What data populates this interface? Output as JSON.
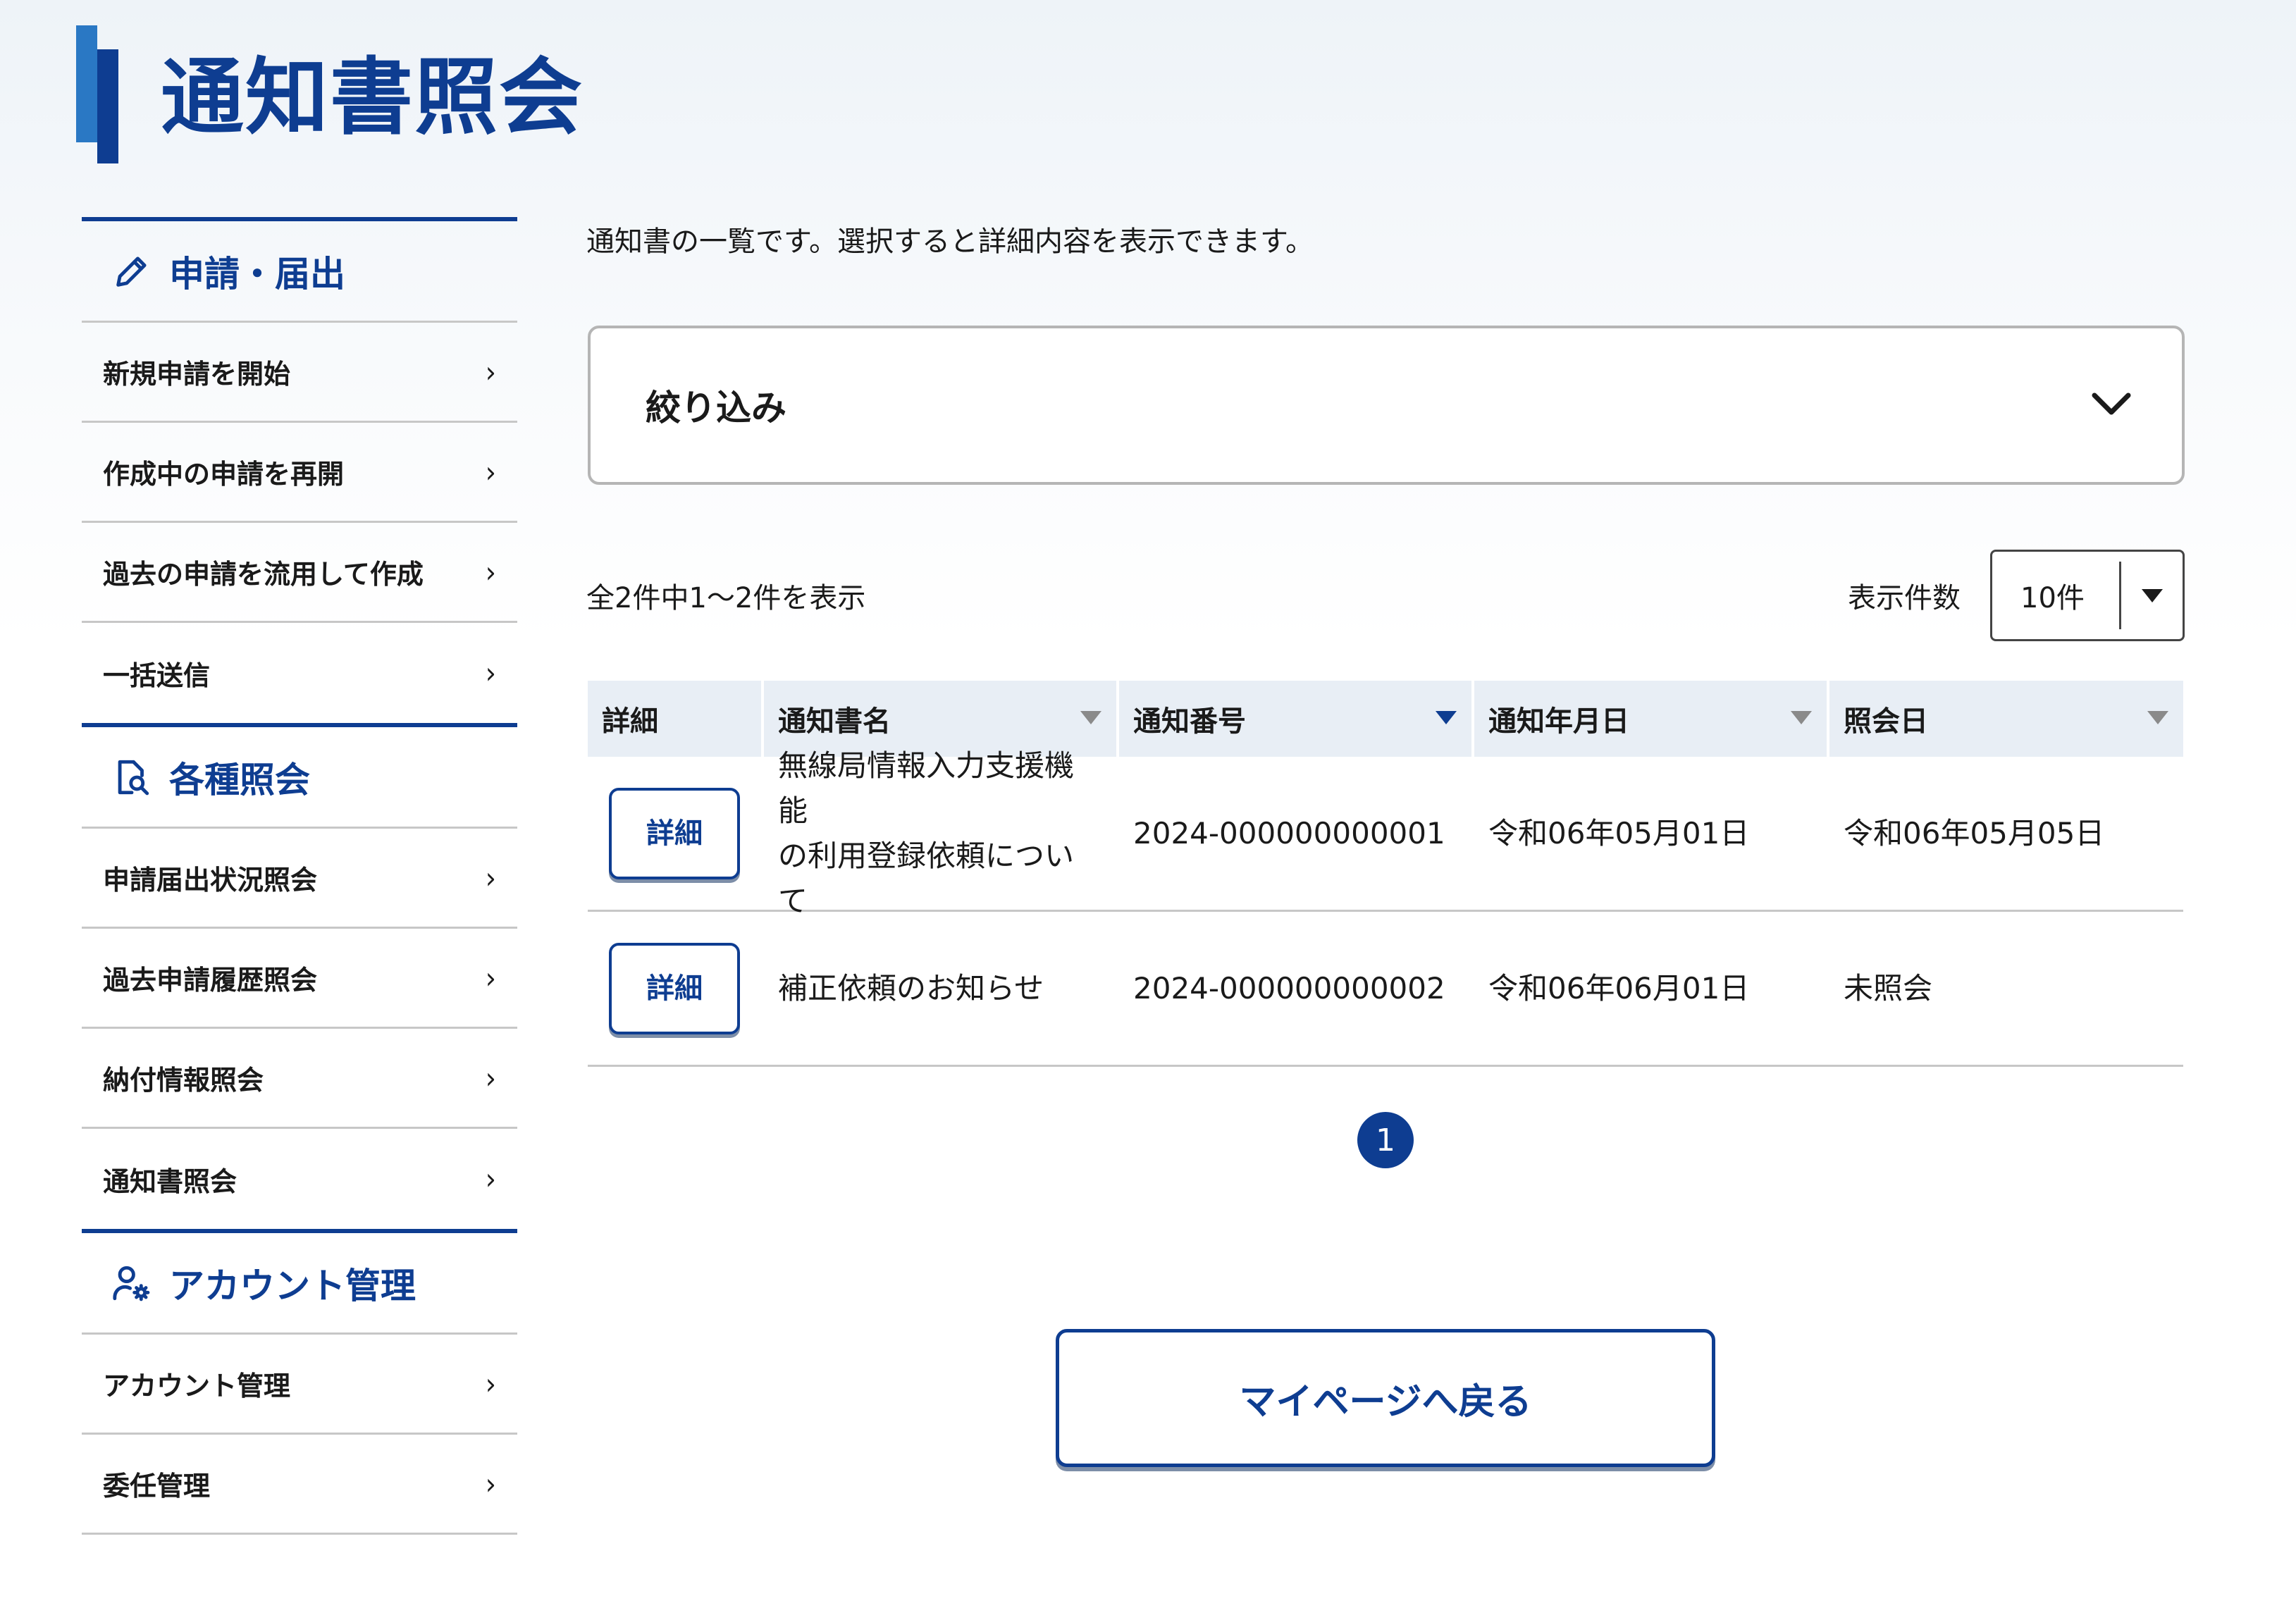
{
  "page": {
    "title": "通知書照会",
    "intro": "通知書の一覧です。選択すると詳細内容を表示できます。"
  },
  "sidebar": {
    "sections": [
      {
        "heading": "申請・届出",
        "icon": "pencil-icon",
        "items": [
          {
            "label": "新規申請を開始"
          },
          {
            "label": "作成中の申請を再開"
          },
          {
            "label": "過去の申請を流用して作成"
          },
          {
            "label": "一括送信"
          }
        ]
      },
      {
        "heading": "各種照会",
        "icon": "document-search-icon",
        "items": [
          {
            "label": "申請届出状況照会"
          },
          {
            "label": "過去申請履歴照会"
          },
          {
            "label": "納付情報照会"
          },
          {
            "label": "通知書照会"
          }
        ]
      },
      {
        "heading": "アカウント管理",
        "icon": "user-gear-icon",
        "items": [
          {
            "label": "アカウント管理"
          },
          {
            "label": "委任管理"
          }
        ]
      }
    ],
    "chevron": "›"
  },
  "filter": {
    "label": "絞り込み",
    "icon": "chevron-down-icon"
  },
  "list": {
    "count_text": "全2件中1〜2件を表示",
    "per_page_label": "表示件数",
    "per_page_value": "10件"
  },
  "table": {
    "headers": [
      "詳細",
      "通知書名",
      "通知番号",
      "通知年月日",
      "照会日"
    ],
    "active_sort_column": 2,
    "rows": [
      {
        "button": "詳細",
        "name_line1": "無線局情報入力支援機能",
        "name_line2": "の利用登録依頼について",
        "number": "2024-000000000001",
        "notice_date": "令和06年05月01日",
        "view_date": "令和06年05月05日"
      },
      {
        "button": "詳細",
        "name_line1": "補正依頼のお知らせ",
        "name_line2": "",
        "number": "2024-000000000002",
        "notice_date": "令和06年06月01日",
        "view_date": "未照会"
      }
    ]
  },
  "pagination": {
    "current": "1"
  },
  "back_button": {
    "label": "マイページへ戻る"
  },
  "colors": {
    "brand": "#0e3d91",
    "brand_light": "#2a78c4",
    "sort_inactive": "#8a8a8a",
    "header_bg": "#e8eef5"
  }
}
